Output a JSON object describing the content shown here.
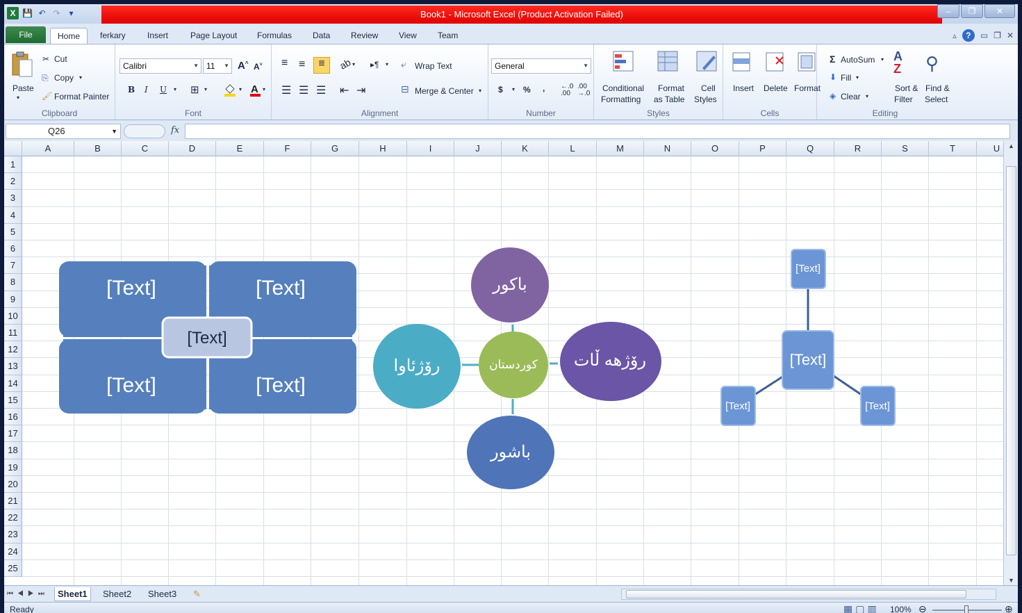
{
  "window": {
    "title": "Book1  -  Microsoft Excel (Product Activation Failed)",
    "accent_red": "#e00000"
  },
  "tabs": {
    "file": "File",
    "items": [
      "Home",
      "ferkary",
      "Insert",
      "Page Layout",
      "Formulas",
      "Data",
      "Review",
      "View",
      "Team"
    ]
  },
  "ribbon": {
    "clipboard": {
      "label": "Clipboard",
      "paste": "Paste",
      "cut": "Cut",
      "copy": "Copy",
      "format_painter": "Format Painter"
    },
    "font": {
      "label": "Font",
      "name": "Calibri",
      "size": "11",
      "bold": "B",
      "italic": "I",
      "underline": "U"
    },
    "alignment": {
      "label": "Alignment",
      "wrap_text": "Wrap Text",
      "merge_center": "Merge & Center"
    },
    "number": {
      "label": "Number",
      "format": "General",
      "currency": "$",
      "percent": "%",
      "comma": ","
    },
    "styles": {
      "label": "Styles",
      "conditional_1": "Conditional",
      "conditional_2": "Formatting",
      "format_table_1": "Format",
      "format_table_2": "as Table",
      "cell_styles_1": "Cell",
      "cell_styles_2": "Styles"
    },
    "cells": {
      "label": "Cells",
      "insert": "Insert",
      "delete": "Delete",
      "format": "Format"
    },
    "editing": {
      "label": "Editing",
      "autosum": "AutoSum",
      "fill": "Fill",
      "clear": "Clear",
      "sort_1": "Sort &",
      "sort_2": "Filter",
      "find_1": "Find &",
      "find_2": "Select"
    }
  },
  "formula_bar": {
    "name_box": "Q26",
    "fx": "fx",
    "value": ""
  },
  "columns": [
    "A",
    "B",
    "C",
    "D",
    "E",
    "F",
    "G",
    "H",
    "I",
    "J",
    "K",
    "L",
    "M",
    "N",
    "O",
    "P",
    "Q",
    "R",
    "S",
    "T",
    "U"
  ],
  "rows": [
    "1",
    "2",
    "3",
    "4",
    "5",
    "6",
    "7",
    "8",
    "9",
    "10",
    "11",
    "12",
    "13",
    "14",
    "15",
    "16",
    "17",
    "18",
    "19",
    "20",
    "21",
    "22",
    "23",
    "24",
    "25"
  ],
  "smartart_matrix": {
    "top_left": "[Text]",
    "top_right": "[Text]",
    "bottom_left": "[Text]",
    "bottom_right": "[Text]",
    "center": "[Text]",
    "color": "#5580bd"
  },
  "smartart_cycle": {
    "center": "كوردستان",
    "top": "باكور",
    "left": "رۆژئاوا",
    "right": "رۆژهه ڵات",
    "bottom": "باشور",
    "colors": {
      "center": "#9bbb59",
      "top": "#8064a2",
      "left": "#4bacc6",
      "right": "#6a55a6",
      "bottom": "#4f74b8"
    }
  },
  "smartart_radial": {
    "center": "[Text]",
    "top": "[Text]",
    "left": "[Text]",
    "right": "[Text]",
    "color": "#6b95d4"
  },
  "sheets": {
    "tabs": [
      "Sheet1",
      "Sheet2",
      "Sheet3"
    ],
    "active": "Sheet1"
  },
  "status": {
    "mode": "Ready",
    "zoom": "100%"
  }
}
